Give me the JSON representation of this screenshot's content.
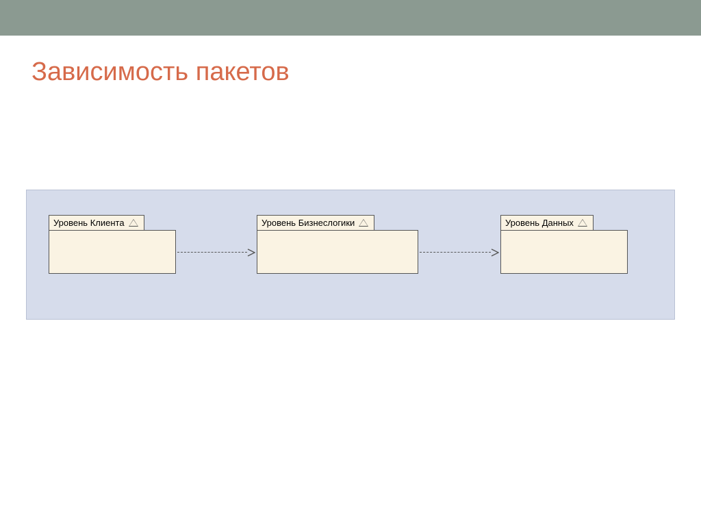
{
  "slide": {
    "title": "Зависимость пакетов"
  },
  "diagram": {
    "packages": [
      {
        "label": "Уровень Клиента"
      },
      {
        "label": "Уровень Бизнеслогики"
      },
      {
        "label": "Уровень Данных"
      }
    ],
    "dependencies": [
      {
        "from": 0,
        "to": 1
      },
      {
        "from": 1,
        "to": 2
      }
    ]
  }
}
